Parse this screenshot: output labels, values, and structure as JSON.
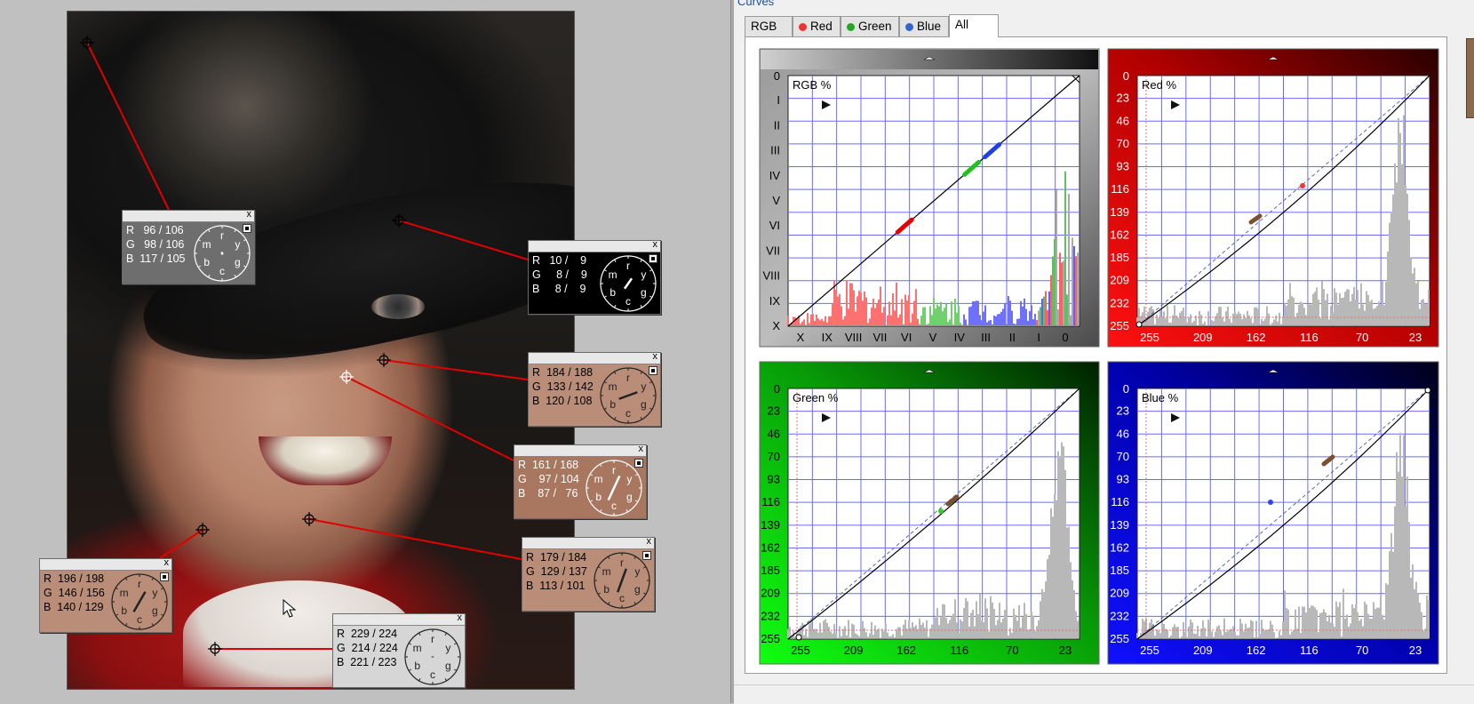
{
  "window": {
    "title": "Curves"
  },
  "tabs": [
    {
      "label": "RGB",
      "dot": null
    },
    {
      "label": "Red",
      "dot": "#e33"
    },
    {
      "label": "Green",
      "dot": "#2a2"
    },
    {
      "label": "Blue",
      "dot": "#36c"
    },
    {
      "label": "All",
      "dot": null,
      "active": true
    }
  ],
  "popups": [
    {
      "id": "p1",
      "r": "R   96 / 106",
      "g": "G   98 / 106",
      "b": "B  117 / 105",
      "style": "gray"
    },
    {
      "id": "p2",
      "r": "R   10 /    9",
      "g": "G     8 /    9",
      "b": "B     8 /    9",
      "style": "dark"
    },
    {
      "id": "p3",
      "r": "R  184 / 188",
      "g": "G  133 / 142",
      "b": "B  120 / 108",
      "style": "skin"
    },
    {
      "id": "p4",
      "r": "R  161 / 168",
      "g": "G    97 / 104",
      "b": "B    87 /   76",
      "style": "skin2"
    },
    {
      "id": "p5",
      "r": "R  179 / 184",
      "g": "G  129 / 137",
      "b": "B  113 / 101",
      "style": "skin"
    },
    {
      "id": "p6",
      "r": "R  196 / 198",
      "g": "G  146 / 156",
      "b": "B  140 / 129",
      "style": "skin"
    },
    {
      "id": "p7",
      "r": "R  229 / 224",
      "g": "G  214 / 224",
      "b": "B  221 / 223",
      "style": "white"
    }
  ],
  "dial_letters": {
    "r": "r",
    "y": "y",
    "g": "g",
    "c": "c",
    "b": "b",
    "m": "m"
  },
  "close_glyph": "x",
  "charts": {
    "rgb": {
      "title": "RGB %",
      "ylabels": [
        "0",
        "I",
        "II",
        "III",
        "IV",
        "V",
        "VI",
        "VII",
        "VIII",
        "IX",
        "X"
      ],
      "xlabels": [
        "X",
        "IX",
        "VIII",
        "VII",
        "VI",
        "V",
        "IV",
        "III",
        "II",
        "I",
        "0"
      ]
    },
    "red": {
      "title": "Red %",
      "ylabels": [
        "0",
        "23",
        "46",
        "70",
        "93",
        "116",
        "139",
        "162",
        "185",
        "209",
        "232",
        "255"
      ],
      "xlabels": [
        "255",
        "209",
        "162",
        "116",
        "70",
        "23"
      ]
    },
    "green": {
      "title": "Green %",
      "ylabels": [
        "0",
        "23",
        "46",
        "70",
        "93",
        "116",
        "139",
        "162",
        "185",
        "209",
        "232",
        "255"
      ],
      "xlabels": [
        "255",
        "209",
        "162",
        "116",
        "70",
        "23"
      ]
    },
    "blue": {
      "title": "Blue %",
      "ylabels": [
        "0",
        "23",
        "46",
        "70",
        "93",
        "116",
        "139",
        "162",
        "185",
        "209",
        "232",
        "255"
      ],
      "xlabels": [
        "255",
        "209",
        "162",
        "116",
        "70",
        "23"
      ]
    }
  },
  "colors": {
    "red_panel": "#b00000",
    "green_panel": "#0a9a0a",
    "blue_panel": "#0000b0",
    "grid": "#6c6cf0",
    "leader": "#e00000"
  }
}
